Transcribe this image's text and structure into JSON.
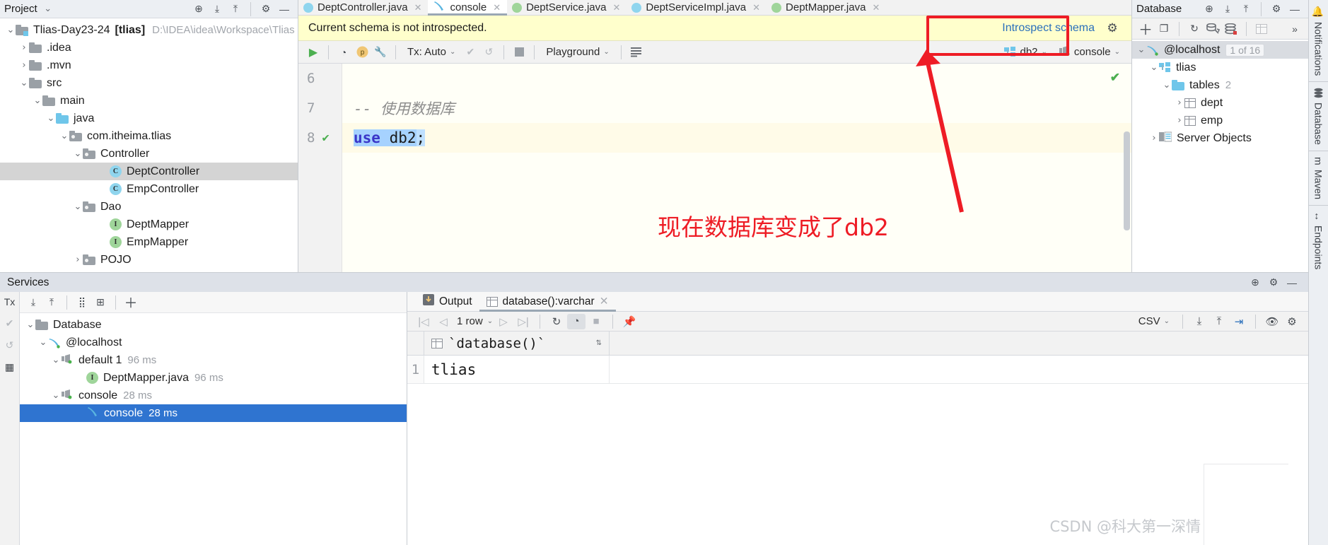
{
  "project": {
    "header_title": "Project",
    "tree": [
      {
        "label": "Tlias-Day23-24",
        "bold_suffix": "[tlias]",
        "path": "D:\\IDEA\\idea\\Workspace\\Tlias",
        "icon": "module-icon",
        "chevron": "v",
        "indent": 0,
        "selected": false
      },
      {
        "label": ".idea",
        "icon": "folder-icon",
        "chevron": ">",
        "indent": 1,
        "selected": false
      },
      {
        "label": ".mvn",
        "icon": "folder-icon",
        "chevron": ">",
        "indent": 1,
        "selected": false
      },
      {
        "label": "src",
        "icon": "folder-icon",
        "chevron": "v",
        "indent": 1,
        "selected": false
      },
      {
        "label": "main",
        "icon": "folder-icon",
        "chevron": "v",
        "indent": 2,
        "selected": false
      },
      {
        "label": "java",
        "icon": "source-folder-icon",
        "chevron": "v",
        "indent": 3,
        "selected": false
      },
      {
        "label": "com.itheima.tlias",
        "icon": "package-icon",
        "chevron": "v",
        "indent": 4,
        "selected": false
      },
      {
        "label": "Controller",
        "icon": "package-icon",
        "chevron": "v",
        "indent": 5,
        "selected": false
      },
      {
        "label": "DeptController",
        "icon": "class-icon",
        "chevron": "",
        "indent": 7,
        "selected": true
      },
      {
        "label": "EmpController",
        "icon": "class-icon",
        "chevron": "",
        "indent": 7,
        "selected": false
      },
      {
        "label": "Dao",
        "icon": "package-icon",
        "chevron": "v",
        "indent": 5,
        "selected": false
      },
      {
        "label": "DeptMapper",
        "icon": "interface-icon",
        "chevron": "",
        "indent": 7,
        "selected": false
      },
      {
        "label": "EmpMapper",
        "icon": "interface-icon",
        "chevron": "",
        "indent": 7,
        "selected": false
      },
      {
        "label": "POJO",
        "icon": "package-icon",
        "chevron": ">",
        "indent": 5,
        "selected": false
      }
    ]
  },
  "editor": {
    "tabs": [
      {
        "label": "DeptController.java",
        "icon": "java-class-icon",
        "active": false
      },
      {
        "label": "console",
        "icon": "console-icon",
        "active": true
      },
      {
        "label": "DeptService.java",
        "icon": "java-interface-icon",
        "active": false
      },
      {
        "label": "DeptServiceImpl.java",
        "icon": "java-class-icon",
        "active": false
      },
      {
        "label": "DeptMapper.java",
        "icon": "java-interface-icon",
        "active": false
      }
    ],
    "notice": {
      "message": "Current schema is not introspected.",
      "action_label": "Introspect schema"
    },
    "toolbar": {
      "run_label": "run-query",
      "tx_label": "Tx: Auto",
      "playground_label": "Playground",
      "schema_label": "db2",
      "session_label": "console"
    },
    "code": {
      "lines": [
        {
          "number": "6",
          "text": "",
          "kind": "empty",
          "has_check": false
        },
        {
          "number": "7",
          "text": "--  使用数据库",
          "kind": "comment",
          "has_check": false
        },
        {
          "number": "8",
          "text": "use db2;",
          "kind": "sql",
          "has_check": true,
          "keyword": "use",
          "rest": " db2",
          "terminator": ";"
        }
      ]
    },
    "annotation": {
      "text": "现在数据库变成了db2",
      "color": "#ee1c25"
    }
  },
  "database_panel": {
    "header_title": "Database",
    "tree": [
      {
        "label": "@localhost",
        "chip": "1 of 16",
        "icon": "mysql-icon",
        "chevron": "v",
        "indent": 0,
        "selected": true
      },
      {
        "label": "tlias",
        "icon": "schema-icon",
        "chevron": "v",
        "indent": 1,
        "selected": false
      },
      {
        "label": "tables",
        "count": "2",
        "icon": "folder-icon-blue",
        "chevron": "v",
        "indent": 2,
        "selected": false
      },
      {
        "label": "dept",
        "icon": "table-icon",
        "chevron": ">",
        "indent": 3,
        "selected": false
      },
      {
        "label": "emp",
        "icon": "table-icon",
        "chevron": ">",
        "indent": 3,
        "selected": false
      },
      {
        "label": "Server Objects",
        "icon": "server-objects-icon",
        "chevron": ">",
        "indent": 1,
        "selected": false
      }
    ]
  },
  "right_rail": {
    "items": [
      {
        "label": "Notifications",
        "icon": "bell-icon"
      },
      {
        "label": "Database",
        "icon": "database-icon"
      },
      {
        "label": "Maven",
        "icon": "maven-icon"
      },
      {
        "label": "Endpoints",
        "icon": "endpoints-icon"
      }
    ]
  },
  "services": {
    "header_title": "Services",
    "rail": {
      "tx_label": "Tx"
    },
    "tree": [
      {
        "label": "Database",
        "icon": "folder-icon",
        "chevron": "v",
        "indent": 0,
        "selected": false
      },
      {
        "label": "@localhost",
        "icon": "mysql-icon",
        "chevron": "v",
        "indent": 1,
        "selected": false
      },
      {
        "label": "default 1",
        "time": "96 ms",
        "icon": "session-icon",
        "chevron": "v",
        "indent": 2,
        "selected": false
      },
      {
        "label": "DeptMapper.java",
        "time": "96 ms",
        "icon": "interface-icon",
        "chevron": "",
        "indent": 4,
        "selected": false
      },
      {
        "label": "console",
        "time": "28 ms",
        "icon": "session-icon",
        "chevron": "v",
        "indent": 2,
        "selected": false
      },
      {
        "label": "console",
        "time": "28 ms",
        "icon": "console-icon",
        "chevron": "",
        "indent": 4,
        "selected": true
      }
    ],
    "result_tabs": [
      {
        "label": "Output",
        "icon": "output-icon",
        "active": false,
        "closable": false
      },
      {
        "label": "database():varchar",
        "icon": "table-icon",
        "active": true,
        "closable": true
      }
    ],
    "result_toolbar": {
      "row_count": "1 row",
      "export_format": "CSV"
    },
    "result_grid": {
      "columns": [
        "`database()`"
      ],
      "rows": [
        {
          "number": "1",
          "values": [
            "tlias"
          ]
        }
      ]
    }
  },
  "watermark": {
    "text": "CSDN @科大第一深情"
  }
}
